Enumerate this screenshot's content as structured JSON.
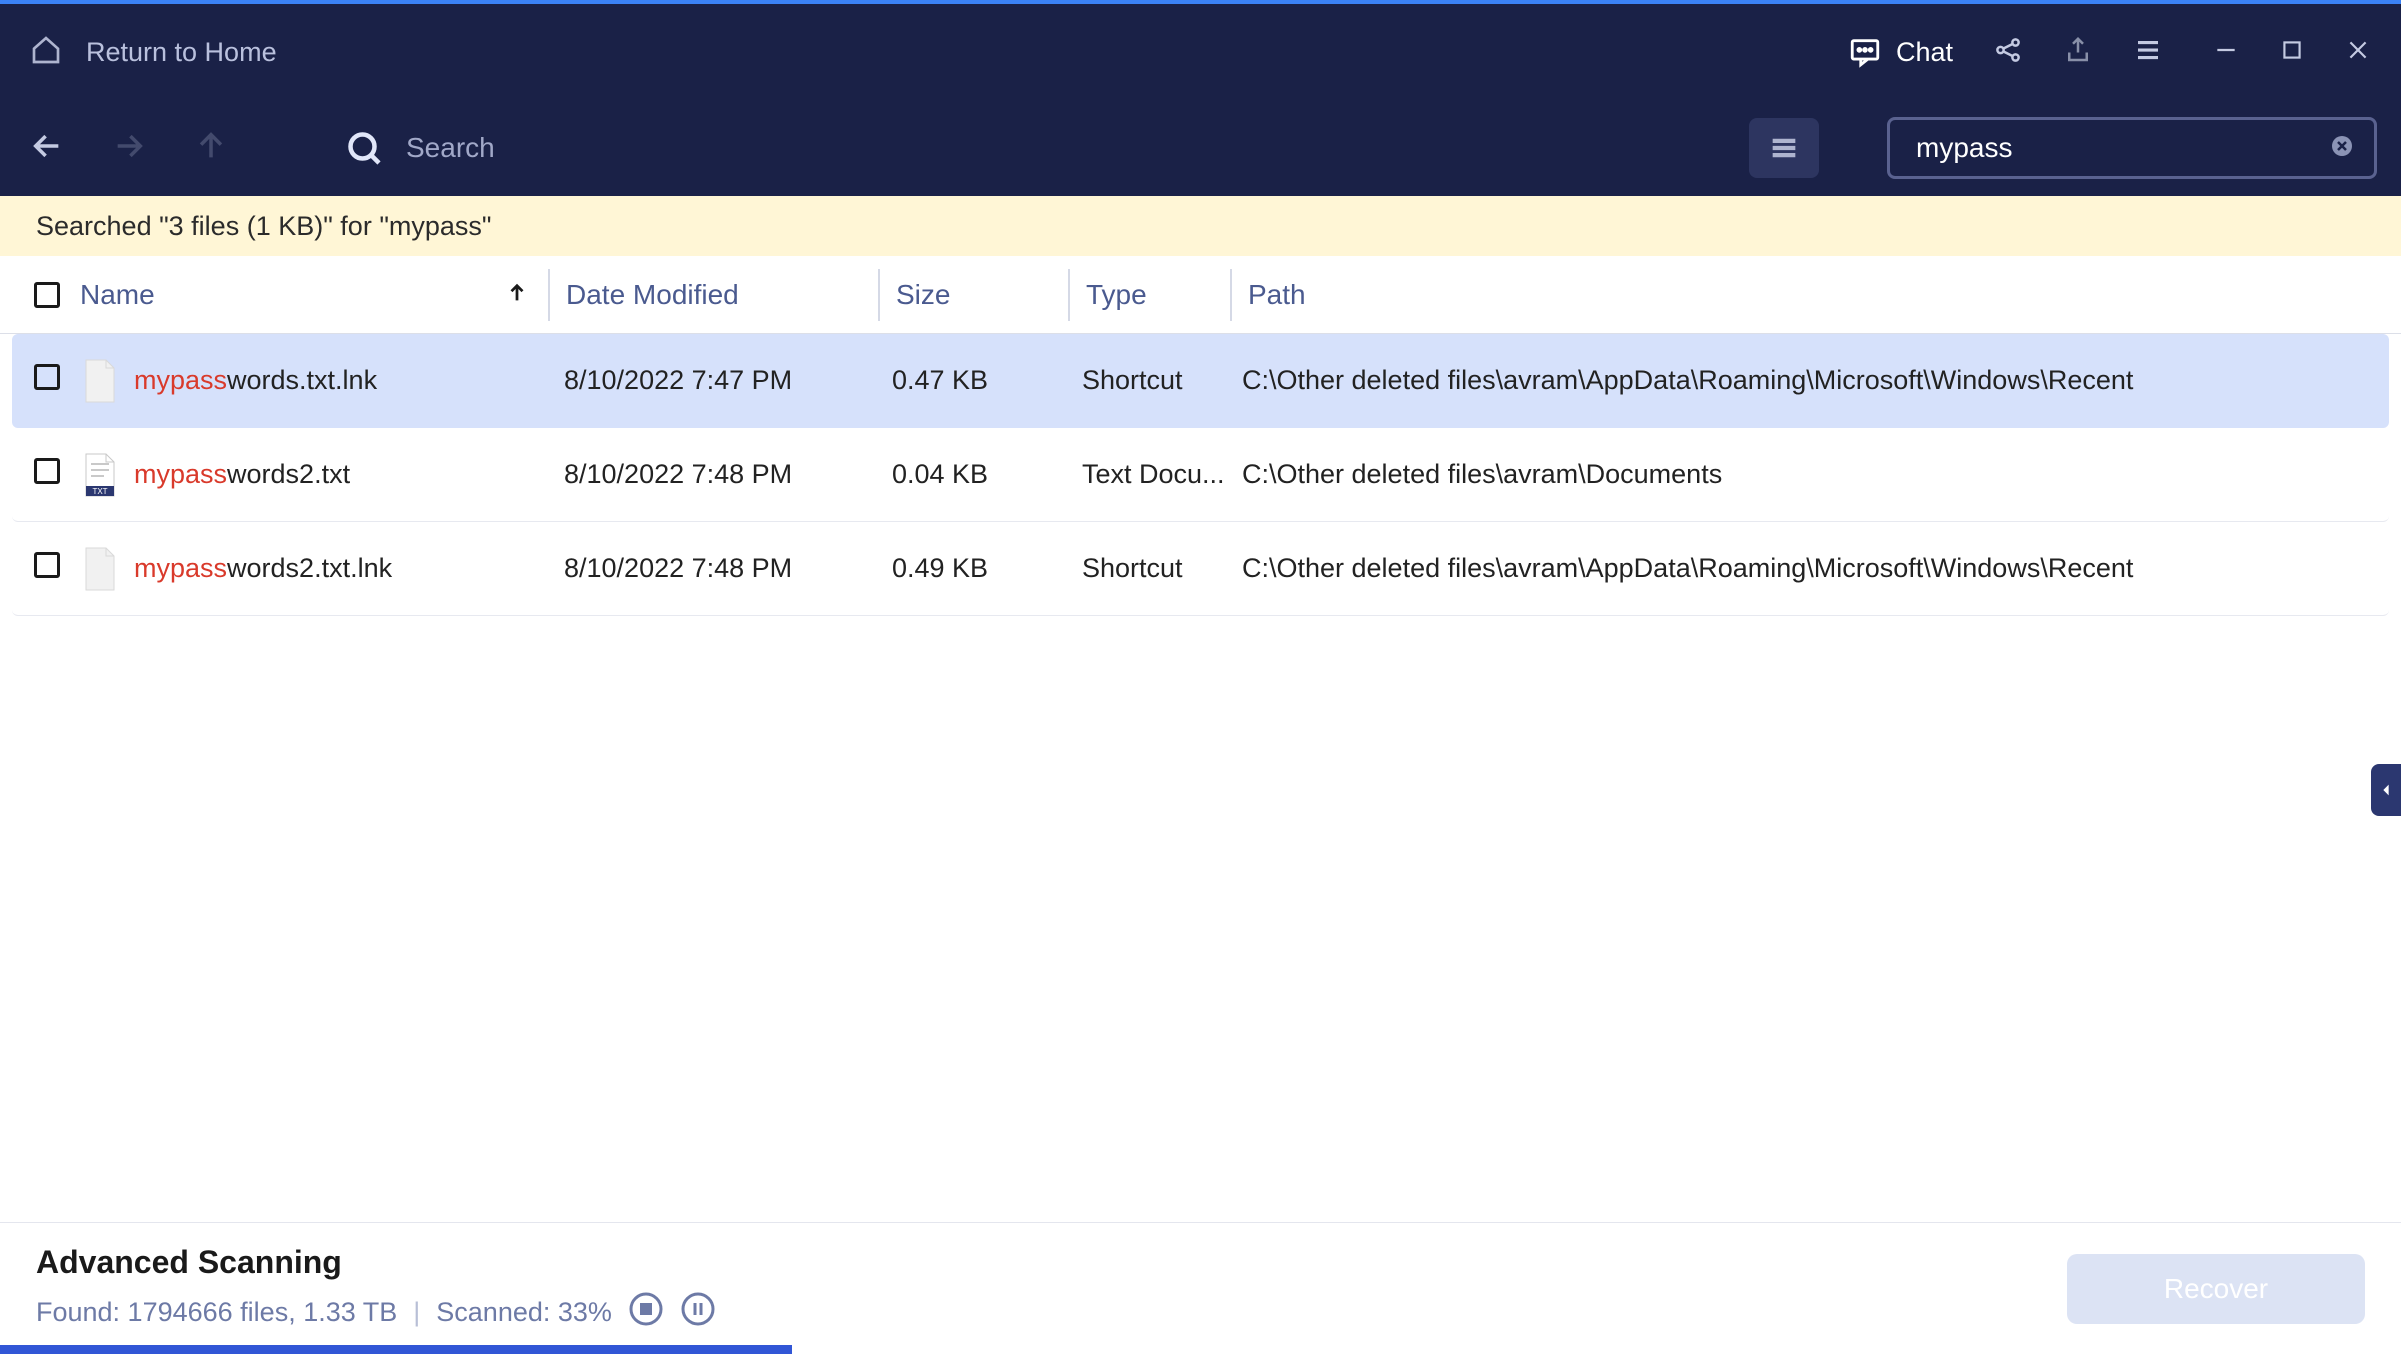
{
  "titlebar": {
    "return_home": "Return to Home",
    "chat_label": "Chat"
  },
  "toolbar": {
    "search_placeholder": "Search",
    "search_value": "mypass"
  },
  "status": {
    "text": "Searched \"3 files (1 KB)\" for \"mypass\""
  },
  "columns": {
    "name": "Name",
    "date": "Date Modified",
    "size": "Size",
    "type": "Type",
    "path": "Path"
  },
  "search_highlight": "mypass",
  "rows": [
    {
      "name_hl": "mypass",
      "name_rest": "words.txt.lnk",
      "date": "8/10/2022 7:47 PM",
      "size": "0.47 KB",
      "type": "Shortcut",
      "path": "C:\\Other deleted files\\avram\\AppData\\Roaming\\Microsoft\\Windows\\Recent",
      "selected": true,
      "icon": "blank"
    },
    {
      "name_hl": "mypass",
      "name_rest": "words2.txt",
      "date": "8/10/2022 7:48 PM",
      "size": "0.04 KB",
      "type": "Text Docu...",
      "path": "C:\\Other deleted files\\avram\\Documents",
      "selected": false,
      "icon": "txt"
    },
    {
      "name_hl": "mypass",
      "name_rest": "words2.txt.lnk",
      "date": "8/10/2022 7:48 PM",
      "size": "0.49 KB",
      "type": "Shortcut",
      "path": "C:\\Other deleted files\\avram\\AppData\\Roaming\\Microsoft\\Windows\\Recent",
      "selected": false,
      "icon": "blank"
    }
  ],
  "footer": {
    "title": "Advanced Scanning",
    "found_label": "Found: 1794666 files, 1.33 TB",
    "scanned_label": "Scanned: 33%",
    "recover_label": "Recover",
    "progress_percent": 33
  }
}
